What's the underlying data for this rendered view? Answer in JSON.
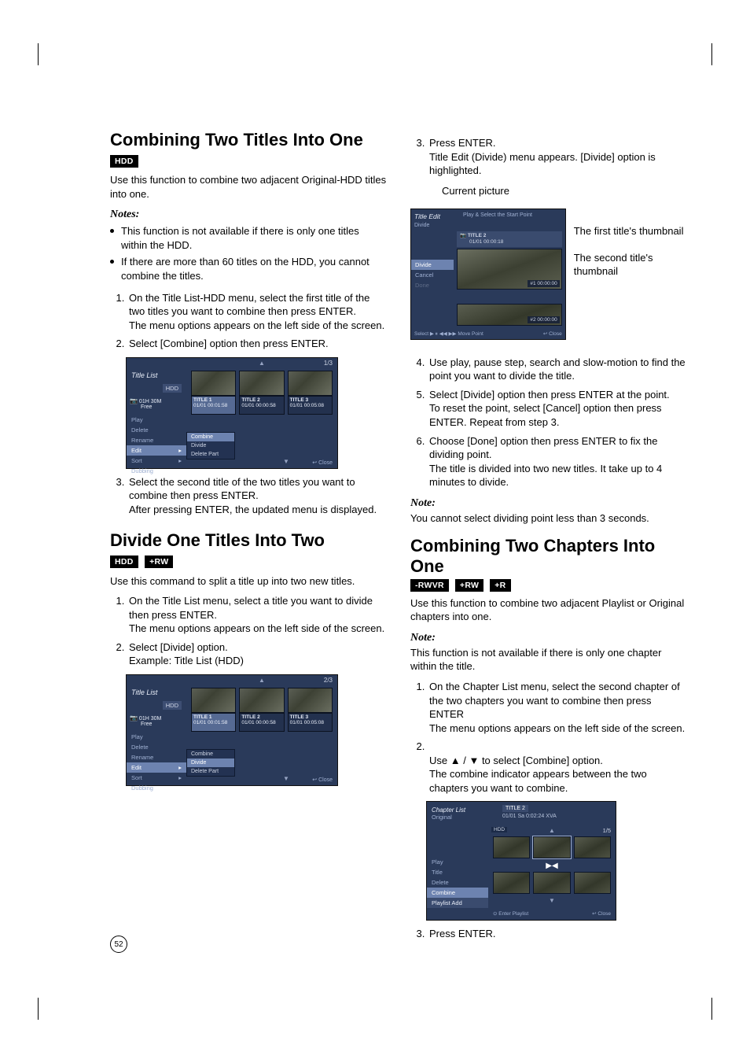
{
  "left": {
    "combine_titles": {
      "heading": "Combining Two Titles Into One",
      "badge_hdd": "HDD",
      "intro": "Use this function to combine two adjacent Original-HDD titles into one.",
      "notes_label": "Notes:",
      "note1": "This function is not available if there is only one titles within the HDD.",
      "note2": "If there are more than 60 titles on the HDD, you cannot combine the titles.",
      "step1": "On the Title List-HDD menu, select the first title of the two titles you want to combine then press ENTER.\nThe menu options appears on the left side of the screen.",
      "step2": "Select [Combine] option then press ENTER.",
      "step3": "Select the second title of the two titles you want to combine then press ENTER.\nAfter pressing ENTER, the updated menu is displayed.",
      "screenshot_a": {
        "title_list": "Title List",
        "hdd": "HDD",
        "page": "1/3",
        "left_info_a": "01H 30M",
        "left_info_b": "Free",
        "t1a": "TITLE 1",
        "t1b": "01/01   00:01:58",
        "t2a": "TITLE 2",
        "t2b": "01/01   00:00:58",
        "t3a": "TITLE 3",
        "t3b": "01/01   00:05:08",
        "m_play": "Play",
        "m_delete": "Delete",
        "m_rename": "Rename",
        "m_edit": "Edit",
        "m_sort": "Sort",
        "m_dubbing": "Dubbing",
        "sm_combine": "Combine",
        "sm_divide": "Divide",
        "sm_deletepart": "Delete Part",
        "close": "Close"
      }
    },
    "divide_title": {
      "heading": "Divide One Titles Into Two",
      "badge_hdd": "HDD",
      "badge_prw": "+RW",
      "intro": "Use this command to split a title up into two new titles.",
      "step1": "On the Title List menu, select a title you want to divide then press ENTER.\nThe menu options appears on the left side of the screen.",
      "step2": "Select [Divide] option.",
      "example_label": "Example: Title List (HDD)",
      "screenshot_b": {
        "title_list": "Title List",
        "hdd": "HDD",
        "page": "2/3",
        "left_info_a": "01H 30M",
        "left_info_b": "Free",
        "t1a": "TITLE 1",
        "t1b": "01/01   00:01:58",
        "t2a": "TITLE 2",
        "t2b": "01/01   00:00:58",
        "t3a": "TITLE 3",
        "t3b": "01/01   00:05:08",
        "m_play": "Play",
        "m_delete": "Delete",
        "m_rename": "Rename",
        "m_edit": "Edit",
        "m_sort": "Sort",
        "m_dubbing": "Dubbing",
        "sm_combine": "Combine",
        "sm_divide": "Divide",
        "sm_deletepart": "Delete Part",
        "close": "Close"
      }
    }
  },
  "right": {
    "divide_continued": {
      "step3": "Press ENTER.\nTitle Edit (Divide) menu appears. [Divide] option is highlighted.",
      "current_picture": "Current picture",
      "first_thumb": "The first title's thumbnail",
      "second_thumb": "The second title's thumbnail",
      "step4": "Use play, pause step, search and slow-motion to find the point you want to divide the title.",
      "step5": "Select [Divide] option then press ENTER at the point.\nTo reset the point, select [Cancel] option then press ENTER. Repeat from step 3.",
      "step6": "Choose [Done] option then press ENTER to fix the dividing point.\nThe title is divided into two new titles. It take up to 4 minutes to divide.",
      "note_label": "Note:",
      "note_body": "You cannot select dividing point less than 3 seconds.",
      "te_shot": {
        "title_edit": "Title Edit",
        "sub": "Divide",
        "hint": "Play & Select the Start Point",
        "info_top": "TITLE 2",
        "info_bottom": "01/01   00:00:18",
        "tag1": "#1   00:00:00",
        "tag2": "#2   00:00:00",
        "m_divide": "Divide",
        "m_cancel": "Cancel",
        "m_done": "Done",
        "footer_left": "Select  ▶ ⏸ ◀◀ ▶▶ Move Point",
        "footer_right": "Close"
      }
    },
    "combine_chapters": {
      "heading": "Combining Two Chapters Into One",
      "badge_rwvr": "-RWVR",
      "badge_prw": "+RW",
      "badge_pr": "+R",
      "intro": "Use this function to combine two adjacent Playlist or Original chapters into one.",
      "note_label": "Note:",
      "note_body": "This function is not available if there is only one chapter within the title.",
      "step1": "On the Chapter List menu, select the second chapter of the two chapters you want to combine then press ENTER\nThe menu options appears on the left side of the screen.",
      "step2_pre": "Use ",
      "step2_mid": " / ",
      "step2_post": " to select [Combine] option.\nThe combine indicator appears between the two chapters you want to combine.",
      "step3": "Press ENTER.",
      "cl_shot": {
        "chapter_list": "Chapter List",
        "original": "Original",
        "info1": "TITLE 2",
        "info2": "01/01 Sa  0:02:24    XVA",
        "hdd": "HDD",
        "page": "1/5",
        "m_play": "Play",
        "m_title": "Title",
        "m_delete": "Delete",
        "m_combine": "Combine",
        "m_playlist": "Playlist Add",
        "footer_left": "Enter   Playlist",
        "footer_right": "Close"
      }
    }
  },
  "page_number": "52"
}
